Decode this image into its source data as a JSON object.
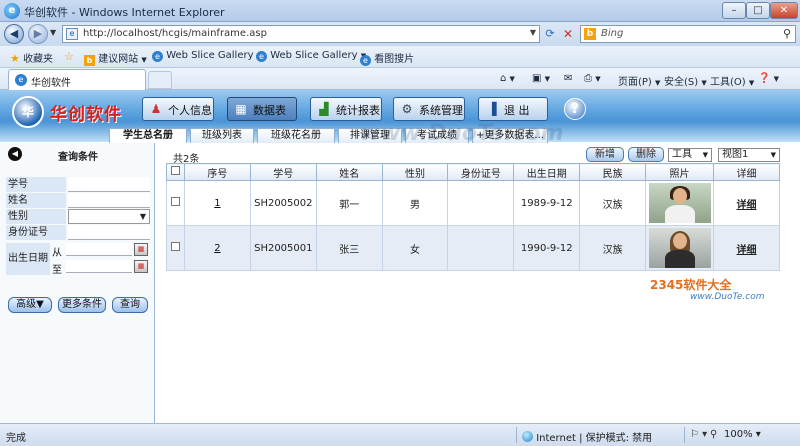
{
  "browser": {
    "window_title": "华创软件 - Windows Internet Explorer",
    "url": "http://localhost/hcgis/mainframe.asp",
    "search_placeholder": "Bing",
    "favorites_label": "收藏夹",
    "favorites": [
      {
        "label": "建议网站"
      },
      {
        "label": "Web Slice Gallery"
      },
      {
        "label": "Web Slice Gallery"
      },
      {
        "label": "看图搜片"
      }
    ],
    "tab_label": "华创软件",
    "commands": {
      "page": "页面(P)",
      "safety": "安全(S)",
      "tools": "工具(O)"
    },
    "status": {
      "done": "完成",
      "zone": "Internet | 保护模式: 禁用",
      "zoom": "100%"
    }
  },
  "app": {
    "logo_text": "华创软件",
    "nav_buttons": [
      {
        "label": "个人信息"
      },
      {
        "label": "数据表"
      },
      {
        "label": "统计报表"
      },
      {
        "label": "系统管理"
      },
      {
        "label": "退  出"
      }
    ],
    "sub_tabs": [
      "学生总名册",
      "班级列表",
      "班级花名册",
      "排课管理",
      "考试成绩",
      "+更多数据表..."
    ],
    "query": {
      "title": "查询条件",
      "fields": [
        "学号",
        "姓名",
        "性别",
        "身份证号"
      ],
      "birth_label": "出生日期",
      "from_label": "从",
      "to_label": "至",
      "buttons": [
        "高级▼",
        "更多条件",
        "查询"
      ]
    },
    "grid": {
      "count_text": "共2条",
      "new_button": "新增",
      "delete_button": "删除",
      "tools_combo": "工具",
      "view_combo": "视图1",
      "columns": [
        "序号",
        "学号",
        "姓名",
        "性别",
        "身份证号",
        "出生日期",
        "民族",
        "照片",
        "详细"
      ],
      "rows": [
        {
          "seq": "1",
          "id": "SH2005002",
          "name": "郭一",
          "gender": "男",
          "idcard": "",
          "birth": "1989-9-12",
          "ethnic": "汉族",
          "detail": "详细"
        },
        {
          "seq": "2",
          "id": "SH2005001",
          "name": "张三",
          "gender": "女",
          "idcard": "",
          "birth": "1990-9-12",
          "ethnic": "汉族",
          "detail": "详细"
        }
      ]
    },
    "watermarks": {
      "main": "www.DuoTe.com",
      "corner_brand": "2345软件大全",
      "corner_url": "www.DuoTe.com"
    }
  }
}
